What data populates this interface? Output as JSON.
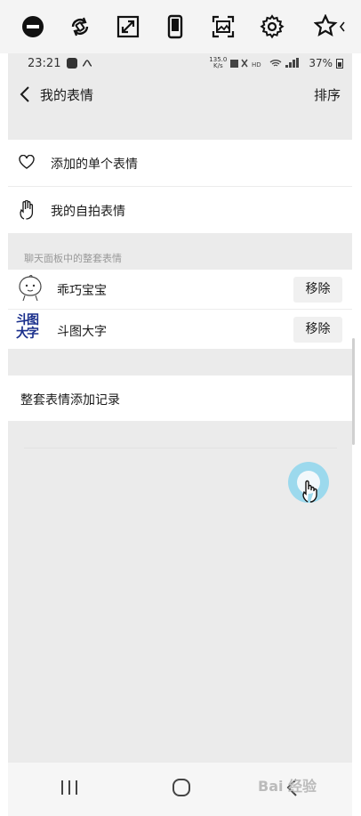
{
  "toolbar": {
    "icons": [
      "minus-circle-icon",
      "rotate-icon",
      "expand-icon",
      "phone-icon",
      "screenshot-icon",
      "gear-icon",
      "star-icon"
    ]
  },
  "statusbar": {
    "time": "23:21",
    "speed_value": "135.0",
    "speed_unit": "K/s",
    "battery": "37%"
  },
  "header": {
    "title": "我的表情",
    "sort_label": "排序"
  },
  "personal": {
    "items": [
      {
        "label": "添加的单个表情",
        "icon": "heart-icon"
      },
      {
        "label": "我的自拍表情",
        "icon": "hand-icon"
      }
    ]
  },
  "sets_section": {
    "label": "聊天面板中的整套表情",
    "items": [
      {
        "name": "乖巧宝宝",
        "action": "移除",
        "icon": "baby-face-icon"
      },
      {
        "name": "斗图大字",
        "action": "移除",
        "icon_text": "斗图大字"
      }
    ]
  },
  "history": {
    "label": "整套表情添加记录"
  },
  "watermark": "Bai 经验",
  "colors": {
    "page_bg": "#ebebeb",
    "row_bg": "#ffffff",
    "button_bg": "#f0f0f0",
    "section_text": "#999999",
    "logo_blue": "#1a2f8c",
    "cursor_ring": "#8fd6ee"
  }
}
